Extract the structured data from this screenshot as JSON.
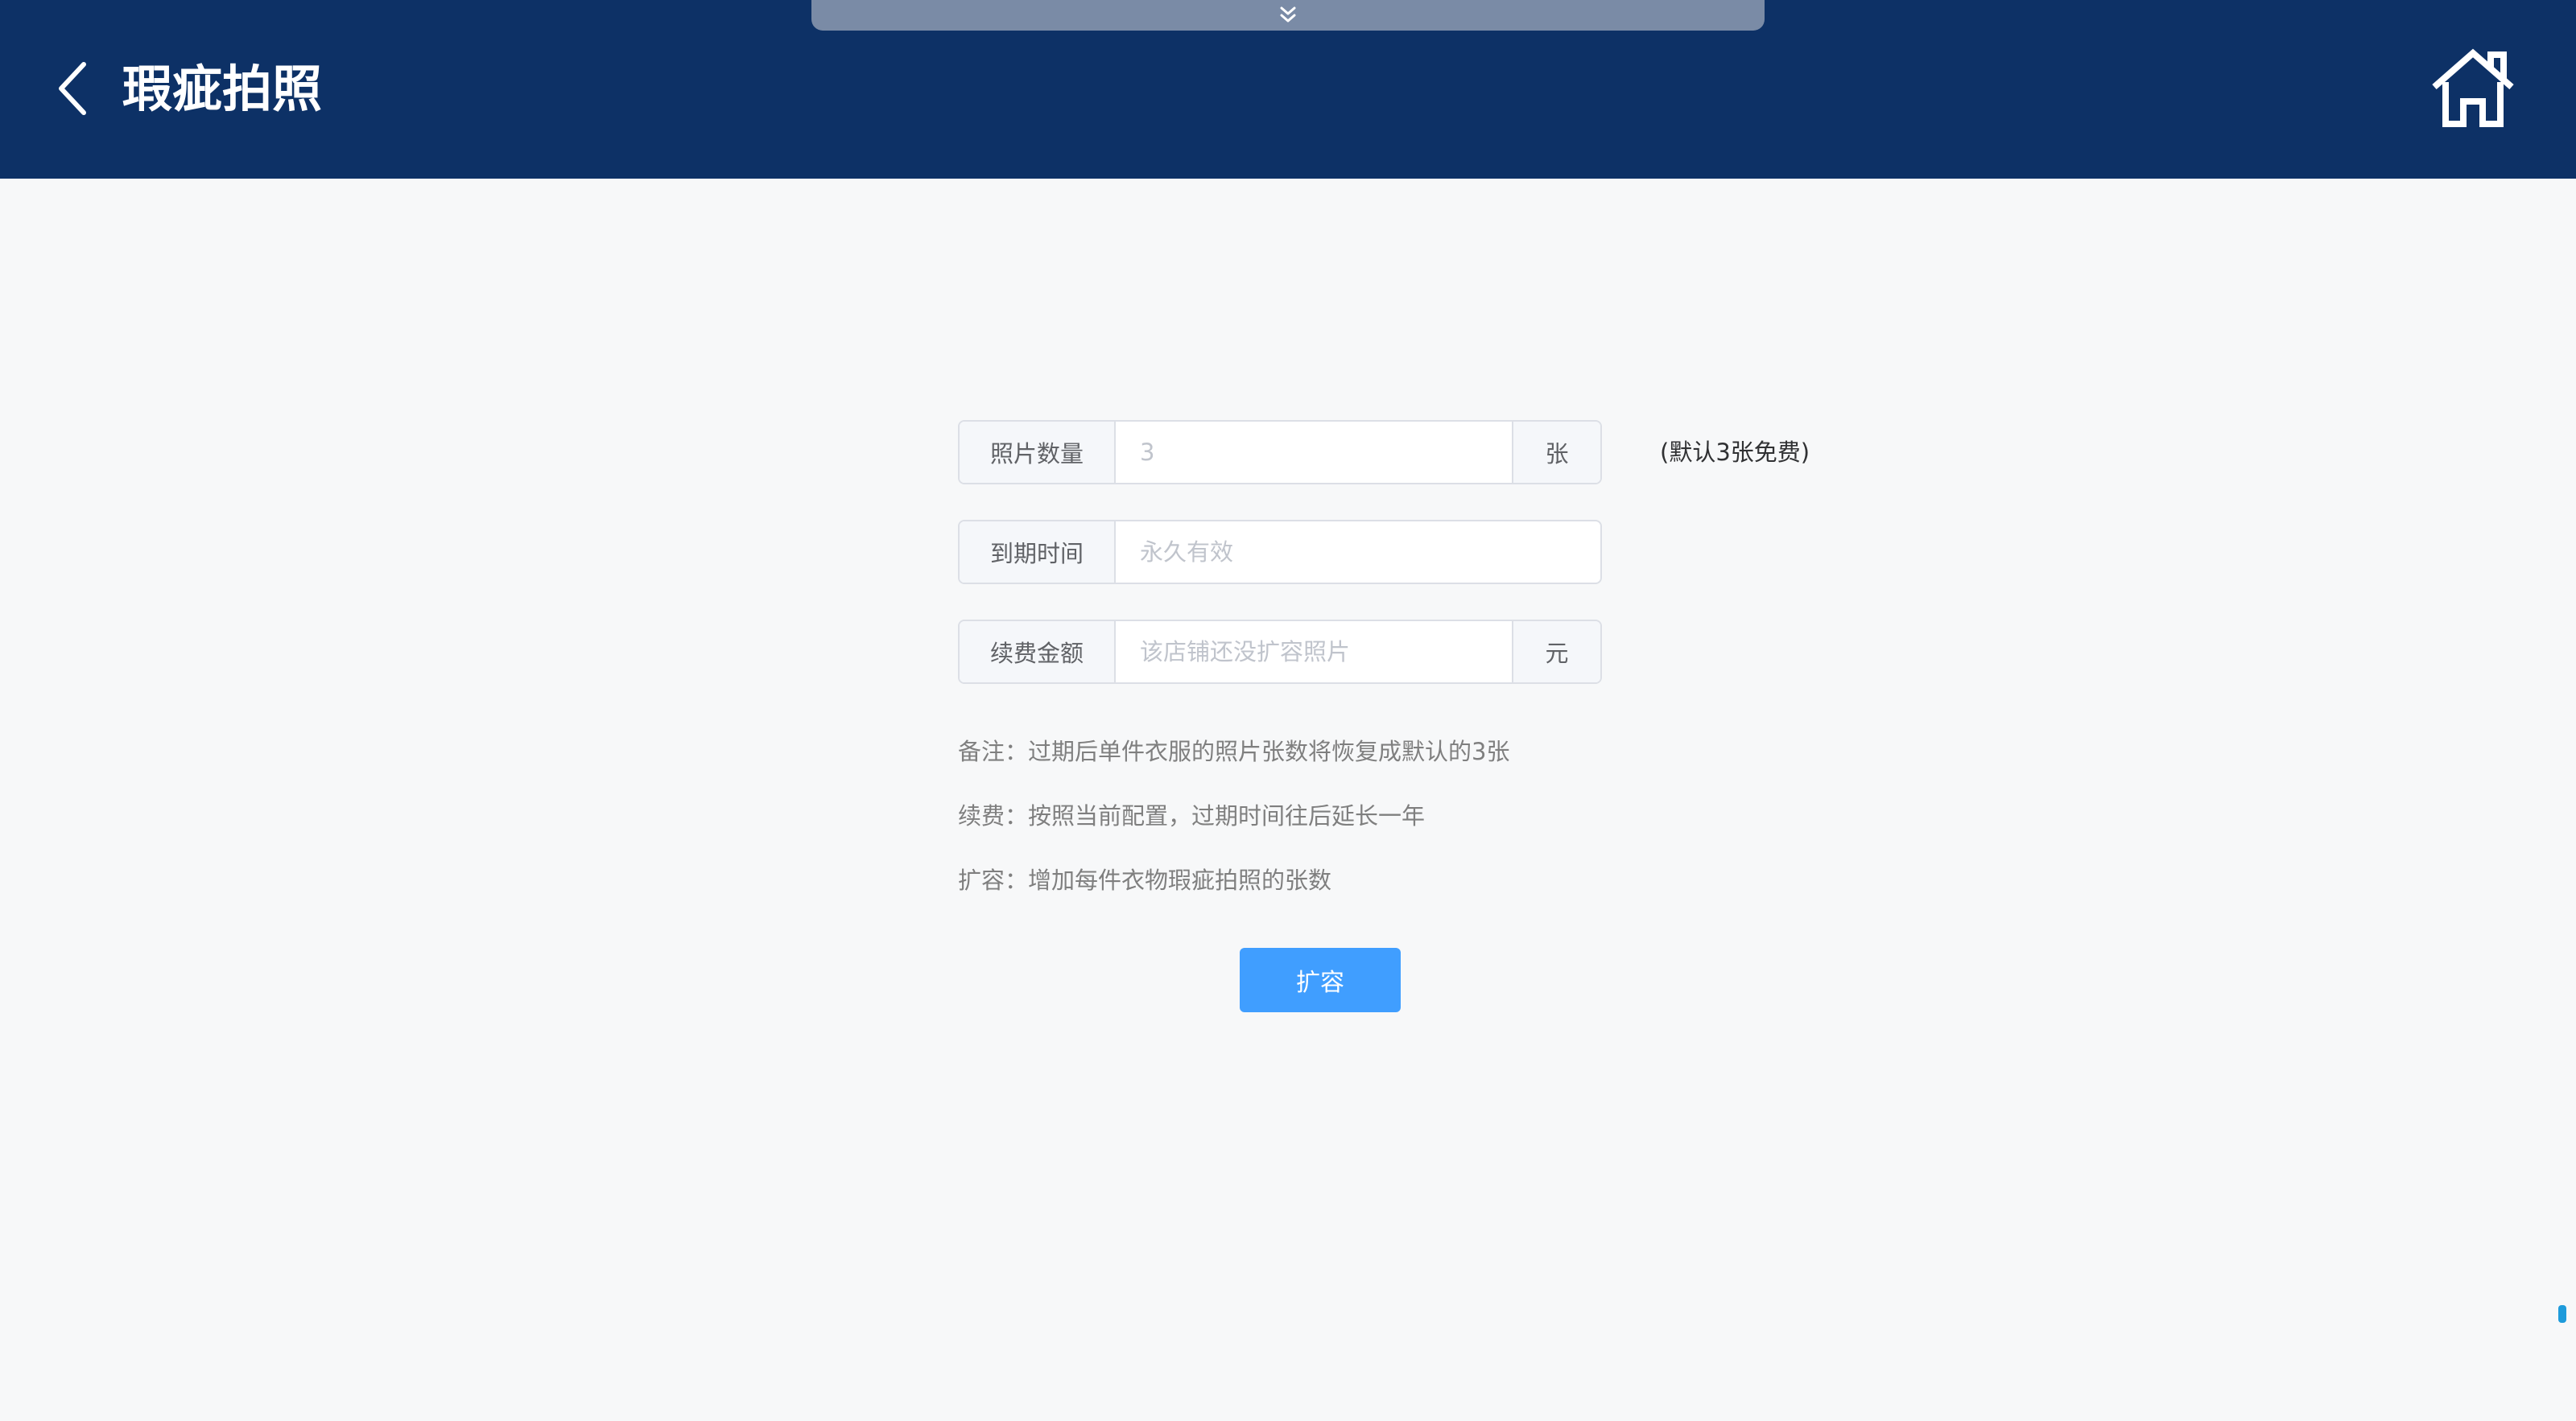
{
  "header": {
    "title": "瑕疵拍照",
    "back_icon": "chevron-left-icon",
    "home_icon": "home-icon",
    "pull_icon": "double-chevron-down-icon",
    "background_color": "#0d3166"
  },
  "form": {
    "photo_count": {
      "label": "照片数量",
      "placeholder": "3",
      "value": "",
      "unit": "张"
    },
    "expiry": {
      "label": "到期时间",
      "placeholder": "永久有效",
      "value": ""
    },
    "renewal": {
      "label": "续费金额",
      "placeholder": "该店铺还没扩容照片",
      "value": "",
      "unit": "元"
    }
  },
  "side_note": "(默认3张免费)",
  "notes": [
    "备注：过期后单件衣服的照片张数将恢复成默认的3张",
    "续费：按照当前配置，过期时间往后延长一年",
    "扩容：增加每件衣物瑕疵拍照的张数"
  ],
  "actions": {
    "expand_label": "扩容",
    "accent_color": "#409eff"
  }
}
